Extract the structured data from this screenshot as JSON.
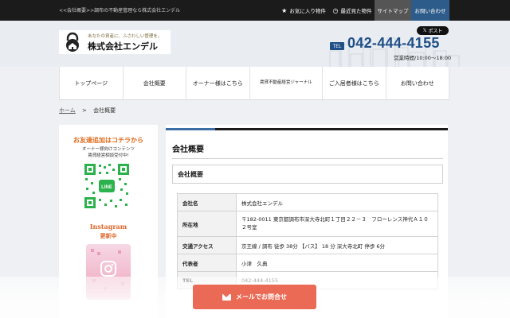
{
  "topbar": {
    "tagline": "<<会社概要>>調布の不動産管理なら株式会社エンデル",
    "favorites": "お気に入り物件",
    "recent": "最近見た物件",
    "sitemap": "サイトマップ",
    "contact": "お問い合わせ"
  },
  "header": {
    "logo_tagline": "あなたの資産に、ふさわしい管理を。",
    "logo_name": "株式会社エンデル",
    "x_post": "ポスト",
    "tel_label": "TEL",
    "tel": "042-444-4155",
    "hours": "営業時間/10:00～18:00"
  },
  "nav": [
    "トップページ",
    "会社概要",
    "オーナー様はこちら",
    "賃貸不動産経営ジャーナル",
    "ご入居者様はこちら",
    "お問い合わせ"
  ],
  "breadcrumb": {
    "home": "ホーム",
    "sep": ">",
    "current": "会社概要"
  },
  "sidebar": {
    "line_title": "お友達追加はコチラから",
    "line_sub1": "オーナー様向けコンテンツ",
    "line_sub2": "賃貸経営相談受付中!",
    "insta_title": "Instagram",
    "insta_sub": "更新中"
  },
  "main": {
    "page_title": "会社概要",
    "section_title": "会社概要",
    "rows": [
      {
        "key": "会社名",
        "value": "株式会社エンデル"
      },
      {
        "key": "所在地",
        "value": "〒182-0011 東京都調布市深大寺北町１丁目２２－３　フローレンス神代Ａ１０２号室"
      },
      {
        "key": "交通アクセス",
        "value": "京王線 / 調布 徒歩 38分 【バス】 18 分 深大寺北町 停歩 6分"
      },
      {
        "key": "代表者",
        "value": "小津　久典"
      },
      {
        "key": "TEL",
        "value": "042-444-4155"
      }
    ]
  },
  "floating": {
    "mail_button": "メールでお問合せ"
  },
  "colors": {
    "accent": "#1f4f86",
    "line_green": "#2bb24c",
    "mail_button": "#ea6a55",
    "orange": "#e06a1a"
  }
}
